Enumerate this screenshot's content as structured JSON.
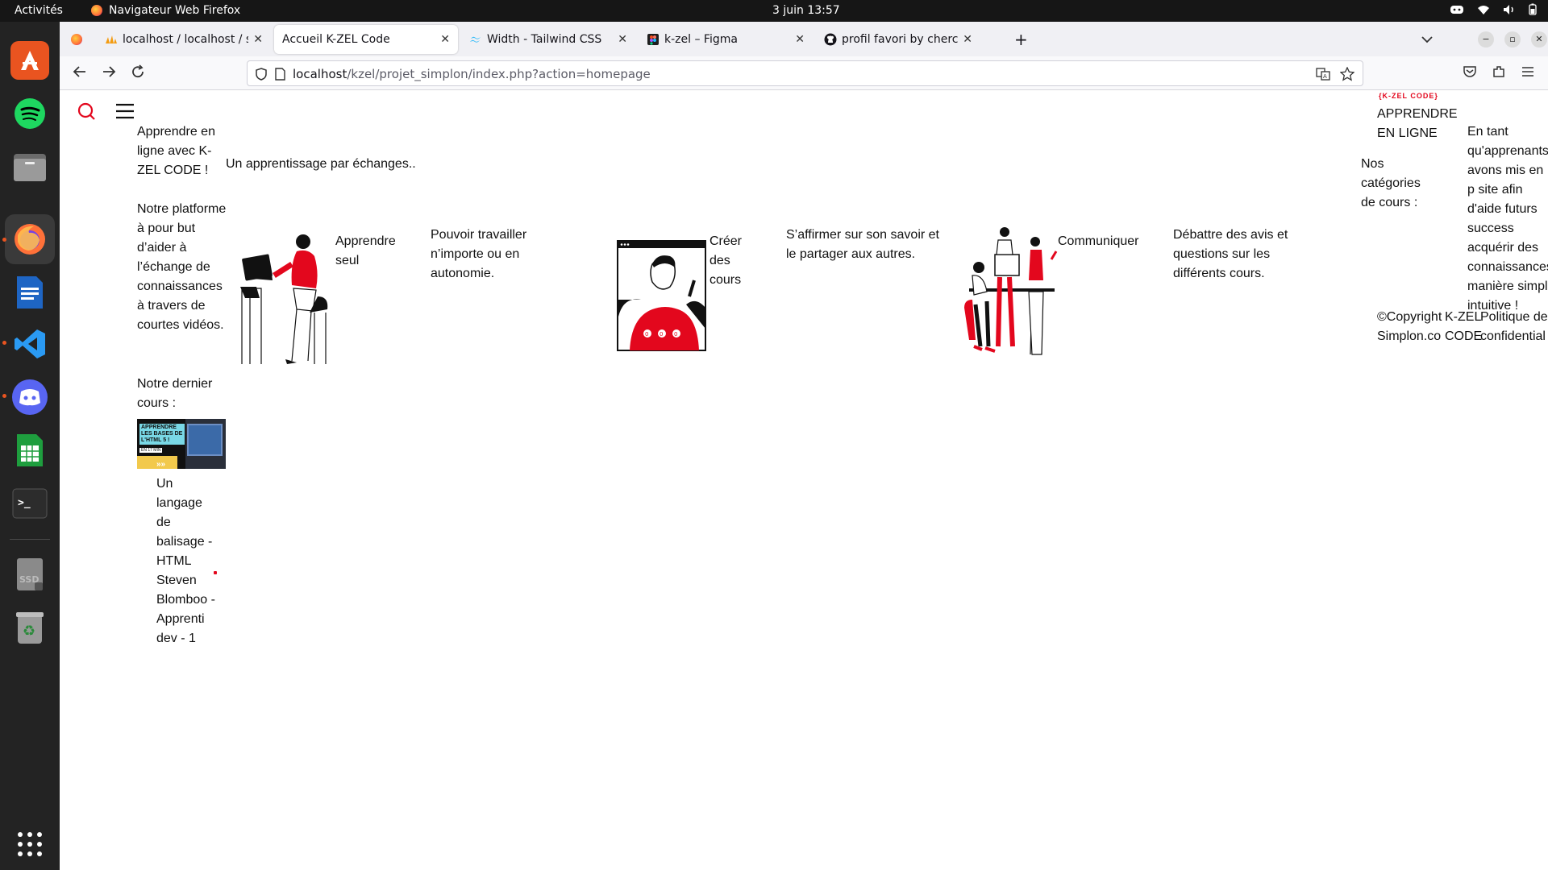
{
  "topbar": {
    "activities": "Activités",
    "app_name": "Navigateur Web Firefox",
    "clock": "3 juin  13:57"
  },
  "dock": {
    "apps": [
      "Ubuntu Software",
      "Spotify",
      "Fichiers",
      "Firefox",
      "LibreOffice Writer",
      "Visual Studio Code",
      "Discord",
      "LibreOffice Calc",
      "Terminal",
      "SSD",
      "Corbeille",
      "Afficher les applications"
    ]
  },
  "browser": {
    "tabs": [
      {
        "label": "localhost / localhost / sim",
        "icon": "phpmyadmin-icon"
      },
      {
        "label": "Accueil K-ZEL Code",
        "icon": "none"
      },
      {
        "label": "Width - Tailwind CSS",
        "icon": "tailwind-icon"
      },
      {
        "label": "k-zel – Figma",
        "icon": "figma-icon"
      },
      {
        "label": "profil favori by chercheto",
        "icon": "github-icon"
      }
    ],
    "url_host": "localhost",
    "url_path": "/kzel/projet_simplon/index.php?action=homepage"
  },
  "page": {
    "intro_title": "Apprendre en ligne avec K-ZEL CODE !",
    "tagline": "Un apprentissage par échanges..",
    "platform_goal": "Notre platforme à pour but d’aider à l’échange de connaissances à travers de courtes vidéos.",
    "last_course_heading": "Notre dernier cours :",
    "last_course_thumb_text": "APPRENDRE LES BASES DE L'HTML 5 !",
    "last_course_thumb_sub": "EN 17 MIN",
    "last_course_title": "Un langage de balisage - HTML Steven Blomboo - Apprenti dev - 1",
    "features": [
      {
        "title": "Apprendre seul",
        "desc": "Pouvoir travailler n’importe ou en autonomie."
      },
      {
        "title": "Créer des cours",
        "desc": "S’affirmer sur son savoir et le partager aux autres."
      },
      {
        "title": "Communiquer",
        "desc": "Débattre des avis et questions sur les différents cours."
      }
    ],
    "logo_text": "{K-ZEL CODE}",
    "brand_line": "APPRENDRE EN LIGNE",
    "categories_heading": "Nos catégories de cours :",
    "learner_text": "En tant qu'apprenants avons mis en p site afin d'aide futurs success acquérir des connaissances manière simpl intuitive !",
    "footer": {
      "copyright": "©Copyright Simplon.co",
      "brand": "K-ZEL CODE",
      "policy": "Politique de confidential"
    },
    "accent_color": "#e3071d"
  }
}
